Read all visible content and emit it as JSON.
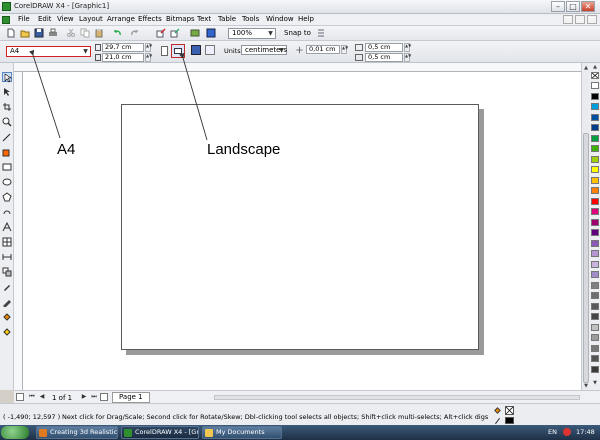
{
  "window": {
    "title": "CorelDRAW X4 - [Graphic1]",
    "min_label": "–",
    "max_label": "□",
    "close_label": "✕"
  },
  "menu": [
    "File",
    "Edit",
    "View",
    "Layout",
    "Arrange",
    "Effects",
    "Bitmaps",
    "Text",
    "Table",
    "Tools",
    "Window",
    "Help"
  ],
  "toolbar": {
    "zoom_value": "100%",
    "snap_label": "Snap to"
  },
  "propbar": {
    "paper_value": "A4",
    "width_value": "29,7 cm",
    "height_value": "21,0 cm",
    "units_label": "Units:",
    "units_value": "centimeters",
    "nudge_value": "0,01 cm",
    "dup_x": "0,5 cm",
    "dup_y": "0,5 cm"
  },
  "annotations": {
    "a4": "A4",
    "landscape": "Landscape"
  },
  "pagenav": {
    "counter": "1 of 1",
    "page_tab": "Page 1"
  },
  "status": {
    "coords": "( -1,490; 12,597 )",
    "hint": "Next click for Drag/Scale; Second click for Rotate/Skew; Dbl-clicking tool selects all objects; Shift+click multi-selects; Alt+click digs"
  },
  "taskbar": {
    "items": [
      "Creating 3d Realistic ...",
      "CorelDRAW X4 - [Gra...",
      "My Documents"
    ],
    "lang": "EN",
    "clock": "17:48"
  },
  "palette": [
    "#ffffff",
    "#000000",
    "#00a0e0",
    "#0050a0",
    "#003c8c",
    "#00a040",
    "#40b000",
    "#a0d000",
    "#ffff00",
    "#ffc000",
    "#ff8000",
    "#ff0000",
    "#e0007a",
    "#a0006e",
    "#600080",
    "#8c5ab4",
    "#b496d2",
    "#c8b4dc",
    "#a08cc8",
    "#808080",
    "#6e6e6e",
    "#5a5a5a",
    "#464646",
    "#c0c0c0",
    "#9c9c9c",
    "#787878",
    "#545454",
    "#3a3a3a"
  ]
}
